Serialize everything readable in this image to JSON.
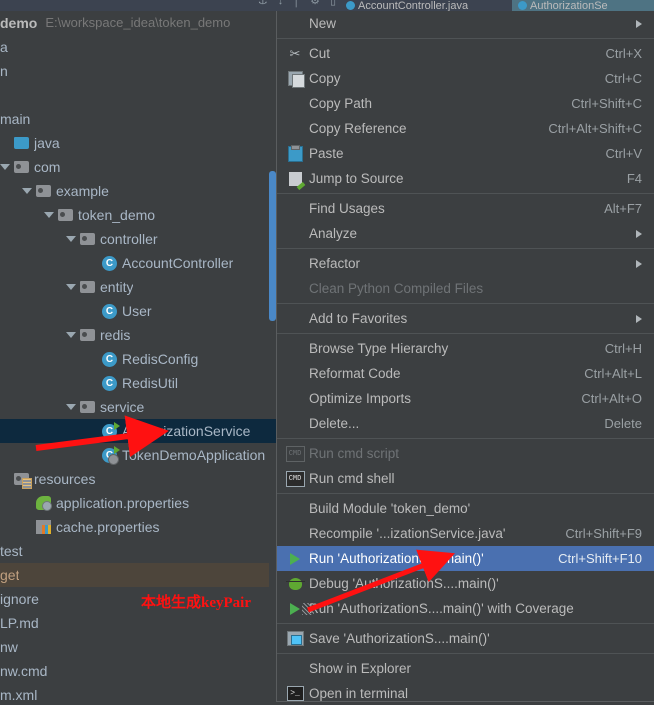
{
  "toolbar": {
    "icons": [
      "anchor-icon",
      "pin-icon",
      "divider-icon",
      "settings-icon",
      "minimize-icon"
    ]
  },
  "tabs": [
    {
      "label": "AccountController.java",
      "icon": "java-class-icon",
      "active": false
    },
    {
      "label": "AuthorizationSe",
      "icon": "java-class-icon",
      "active": true
    }
  ],
  "tree": {
    "rows": [
      {
        "id": "project-root",
        "label": "demo",
        "path": "E:\\workspace_idea\\token_demo",
        "indent": 0,
        "icon": "none",
        "arrow": false,
        "bold": true,
        "state": "normal"
      },
      {
        "id": "idea-folder",
        "label": "a",
        "indent": 0,
        "icon": "none",
        "arrow": false,
        "state": "normal"
      },
      {
        "id": "mvn-folder",
        "label": "n",
        "indent": 0,
        "icon": "none",
        "arrow": false,
        "state": "normal"
      },
      {
        "id": "spacer",
        "label": "",
        "indent": 0,
        "icon": "none",
        "arrow": false,
        "state": "normal"
      },
      {
        "id": "main-folder",
        "label": "main",
        "indent": 0,
        "icon": "none",
        "arrow": false,
        "state": "normal"
      },
      {
        "id": "java-folder",
        "label": "java",
        "indent": 0,
        "icon": "source-folder-icon",
        "arrow": false,
        "state": "normal"
      },
      {
        "id": "com-package",
        "label": "com",
        "indent": 0,
        "icon": "folder-icon",
        "arrow": true,
        "state": "normal"
      },
      {
        "id": "example-package",
        "label": "example",
        "indent": 1,
        "icon": "folder-icon",
        "arrow": true,
        "state": "normal"
      },
      {
        "id": "token-demo-package",
        "label": "token_demo",
        "indent": 2,
        "icon": "folder-icon",
        "arrow": true,
        "state": "normal"
      },
      {
        "id": "controller-package",
        "label": "controller",
        "indent": 3,
        "icon": "folder-icon",
        "arrow": true,
        "state": "normal"
      },
      {
        "id": "account-controller",
        "label": "AccountController",
        "indent": 4,
        "icon": "java-class-icon",
        "arrow": false,
        "state": "normal"
      },
      {
        "id": "entity-package",
        "label": "entity",
        "indent": 3,
        "icon": "folder-icon",
        "arrow": true,
        "state": "normal"
      },
      {
        "id": "user-class",
        "label": "User",
        "indent": 4,
        "icon": "java-class-icon",
        "arrow": false,
        "state": "normal"
      },
      {
        "id": "redis-package",
        "label": "redis",
        "indent": 3,
        "icon": "folder-icon",
        "arrow": true,
        "state": "normal"
      },
      {
        "id": "redis-config",
        "label": "RedisConfig",
        "indent": 4,
        "icon": "java-class-icon",
        "arrow": false,
        "state": "normal"
      },
      {
        "id": "redis-util",
        "label": "RedisUtil",
        "indent": 4,
        "icon": "java-class-icon",
        "arrow": false,
        "state": "normal"
      },
      {
        "id": "service-package",
        "label": "service",
        "indent": 3,
        "icon": "folder-icon",
        "arrow": true,
        "state": "normal"
      },
      {
        "id": "authorization-service",
        "label": "AuthorizationService",
        "indent": 4,
        "icon": "runnable-class-icon",
        "arrow": false,
        "state": "selected"
      },
      {
        "id": "token-demo-application",
        "label": "TokenDemoApplication",
        "indent": 4,
        "icon": "spring-boot-class-icon",
        "arrow": false,
        "state": "normal"
      },
      {
        "id": "resources-folder",
        "label": "resources",
        "indent": 0,
        "icon": "resources-folder-icon",
        "arrow": false,
        "state": "normal"
      },
      {
        "id": "application-properties",
        "label": "application.properties",
        "indent": 1,
        "icon": "spring-properties-icon",
        "arrow": false,
        "state": "normal"
      },
      {
        "id": "cache-properties",
        "label": "cache.properties",
        "indent": 1,
        "icon": "properties-icon",
        "arrow": false,
        "state": "normal"
      },
      {
        "id": "test-folder",
        "label": "test",
        "indent": 0,
        "icon": "none",
        "arrow": false,
        "state": "normal"
      },
      {
        "id": "target-folder",
        "label": "get",
        "indent": 0,
        "icon": "none",
        "arrow": false,
        "state": "target"
      },
      {
        "id": "gitignore-file",
        "label": "ignore",
        "indent": 0,
        "icon": "none",
        "arrow": false,
        "state": "normal"
      },
      {
        "id": "help-md-file",
        "label": "LP.md",
        "indent": 0,
        "icon": "none",
        "arrow": false,
        "state": "normal"
      },
      {
        "id": "mvnw-file",
        "label": "nw",
        "indent": 0,
        "icon": "none",
        "arrow": false,
        "state": "normal"
      },
      {
        "id": "mvnw-cmd-file",
        "label": "nw.cmd",
        "indent": 0,
        "icon": "none",
        "arrow": false,
        "state": "normal"
      },
      {
        "id": "pom-xml-file",
        "label": "m.xml",
        "indent": 0,
        "icon": "none",
        "arrow": false,
        "state": "normal"
      }
    ]
  },
  "context_menu": {
    "items": [
      {
        "label": "New",
        "shortcut": "",
        "icon": "none",
        "submenu": true,
        "state": "normal"
      },
      {
        "separator": true
      },
      {
        "label": "Cut",
        "shortcut": "Ctrl+X",
        "icon": "scissors-icon",
        "submenu": false,
        "state": "normal"
      },
      {
        "label": "Copy",
        "shortcut": "Ctrl+C",
        "icon": "copy-icon",
        "submenu": false,
        "state": "normal"
      },
      {
        "label": "Copy Path",
        "shortcut": "Ctrl+Shift+C",
        "icon": "none",
        "submenu": false,
        "state": "normal"
      },
      {
        "label": "Copy Reference",
        "shortcut": "Ctrl+Alt+Shift+C",
        "icon": "none",
        "submenu": false,
        "state": "normal"
      },
      {
        "label": "Paste",
        "shortcut": "Ctrl+V",
        "icon": "paste-icon",
        "submenu": false,
        "state": "normal"
      },
      {
        "label": "Jump to Source",
        "shortcut": "F4",
        "icon": "jump-to-source-icon",
        "submenu": false,
        "state": "normal"
      },
      {
        "separator": true
      },
      {
        "label": "Find Usages",
        "shortcut": "Alt+F7",
        "icon": "none",
        "submenu": false,
        "state": "normal"
      },
      {
        "label": "Analyze",
        "shortcut": "",
        "icon": "none",
        "submenu": true,
        "state": "normal"
      },
      {
        "separator": true
      },
      {
        "label": "Refactor",
        "shortcut": "",
        "icon": "none",
        "submenu": true,
        "state": "normal"
      },
      {
        "label": "Clean Python Compiled Files",
        "shortcut": "",
        "icon": "none",
        "submenu": false,
        "state": "disabled"
      },
      {
        "separator": true
      },
      {
        "label": "Add to Favorites",
        "shortcut": "",
        "icon": "none",
        "submenu": true,
        "state": "normal"
      },
      {
        "separator": true
      },
      {
        "label": "Browse Type Hierarchy",
        "shortcut": "Ctrl+H",
        "icon": "none",
        "submenu": false,
        "state": "normal"
      },
      {
        "label": "Reformat Code",
        "shortcut": "Ctrl+Alt+L",
        "icon": "none",
        "submenu": false,
        "state": "normal"
      },
      {
        "label": "Optimize Imports",
        "shortcut": "Ctrl+Alt+O",
        "icon": "none",
        "submenu": false,
        "state": "normal"
      },
      {
        "label": "Delete...",
        "shortcut": "Delete",
        "icon": "none",
        "submenu": false,
        "state": "normal"
      },
      {
        "separator": true
      },
      {
        "label": "Run cmd script",
        "shortcut": "",
        "icon": "cmd-icon-disabled",
        "submenu": false,
        "state": "disabled"
      },
      {
        "label": "Run cmd shell",
        "shortcut": "",
        "icon": "cmd-icon",
        "submenu": false,
        "state": "normal"
      },
      {
        "separator": true
      },
      {
        "label": "Build Module 'token_demo'",
        "shortcut": "",
        "icon": "none",
        "submenu": false,
        "state": "normal"
      },
      {
        "label": "Recompile '...izationService.java'",
        "shortcut": "Ctrl+Shift+F9",
        "icon": "none",
        "submenu": false,
        "state": "normal"
      },
      {
        "label": "Run 'AuthorizationS....main()'",
        "shortcut": "Ctrl+Shift+F10",
        "icon": "run-icon",
        "submenu": false,
        "state": "selected"
      },
      {
        "label": "Debug 'AuthorizationS....main()'",
        "shortcut": "",
        "icon": "debug-icon",
        "submenu": false,
        "state": "normal"
      },
      {
        "label": "Run 'AuthorizationS....main()' with Coverage",
        "shortcut": "",
        "icon": "coverage-icon",
        "submenu": false,
        "state": "normal"
      },
      {
        "separator": true
      },
      {
        "label": "Save 'AuthorizationS....main()'",
        "shortcut": "",
        "icon": "save-icon",
        "submenu": false,
        "state": "normal"
      },
      {
        "separator": true
      },
      {
        "label": "Show in Explorer",
        "shortcut": "",
        "icon": "none",
        "submenu": false,
        "state": "normal"
      },
      {
        "label": "Open in terminal",
        "shortcut": "",
        "icon": "terminal-icon",
        "submenu": false,
        "state": "normal"
      }
    ]
  },
  "annotations": {
    "note": "本地生成keyPair",
    "arrow_color": "#ff1111"
  }
}
